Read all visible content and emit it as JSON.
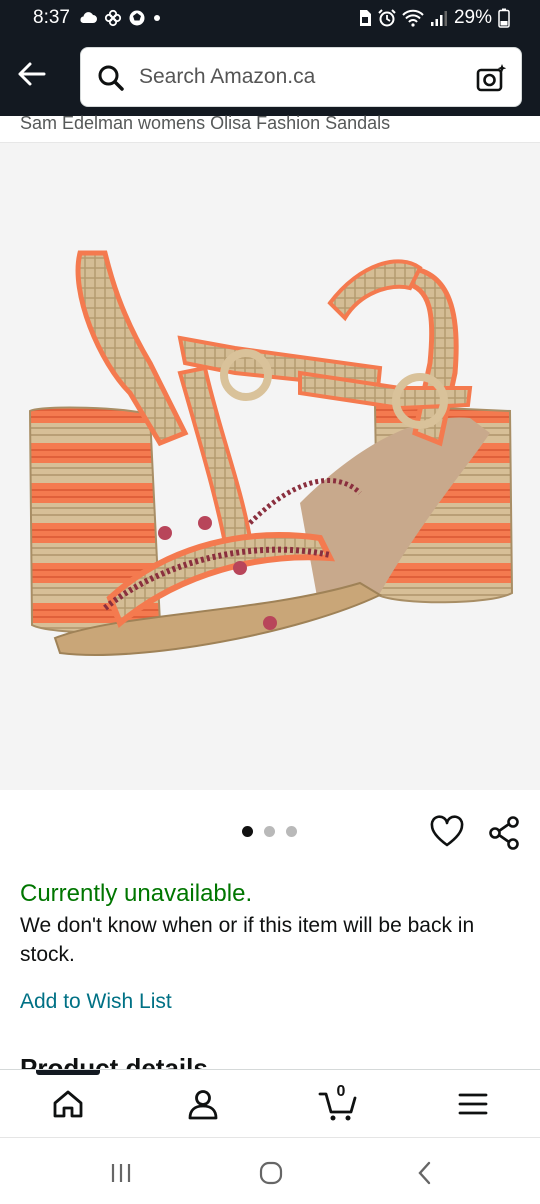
{
  "status_bar": {
    "time": "8:37",
    "battery": "29%",
    "left_icons": [
      "cloud-icon",
      "pinwheel-icon",
      "sports-ball-icon",
      "dot-icon"
    ],
    "right_icons": [
      "sim-icon",
      "alarm-icon",
      "wifi-icon",
      "signal-icon",
      "battery-icon"
    ]
  },
  "header": {
    "search_placeholder": "Search Amazon.ca"
  },
  "product": {
    "title": "Sam Edelman womens Olisa Fashion Sandals",
    "image_count": 3,
    "active_image": 1
  },
  "availability": {
    "status": "Currently unavailable.",
    "note": "We don't know when or if this item will be back in stock."
  },
  "actions": {
    "wishlist_label": "Add to Wish List"
  },
  "section_heading": "Product details",
  "bottom_nav": {
    "items": [
      "home-icon",
      "account-icon",
      "cart-icon",
      "menu-icon"
    ],
    "cart_count": "0"
  },
  "colors": {
    "header_bg": "#131921",
    "available_green": "#007600",
    "link_teal": "#007185",
    "sandal_orange": "#f47a4f",
    "raffia_tan": "#cfb68e"
  }
}
